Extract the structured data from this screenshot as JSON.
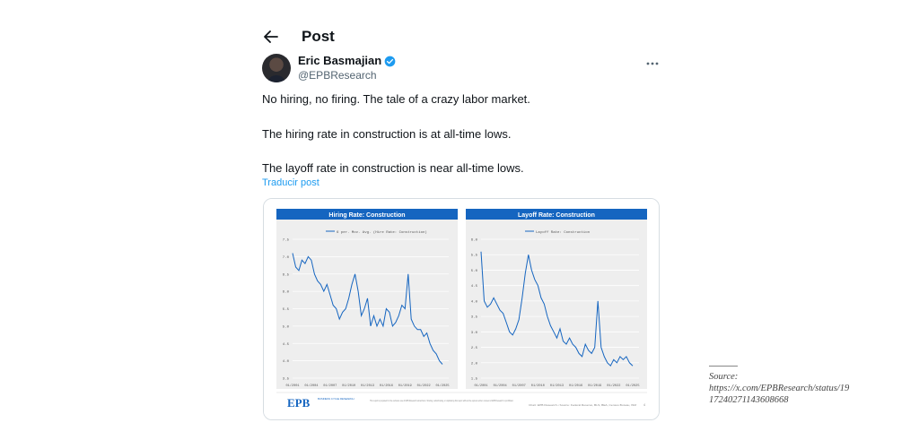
{
  "header": {
    "title": "Post",
    "back_icon": "arrow-left-icon"
  },
  "author": {
    "name": "Eric Basmajian",
    "handle": "@EPBResearch",
    "verified": true,
    "verified_color": "#1d9bf0"
  },
  "tweet": {
    "lines": [
      "No hiring, no firing. The tale of a crazy labor market.",
      "The hiring rate in construction is at all-time lows.",
      "The layoff rate in construction is near all-time lows."
    ],
    "translate_label": "Traducir post"
  },
  "charts_panel": {
    "brand_logo": "EPB",
    "brand_tagline": "BUSINESS CYCLE RESEARCH",
    "disclaimer": "This report is prepared for the exclusive use of EPB Research subscribers. Sharing, redistributing, or duplicating this report without the express written consent of EPB Research is prohibited.",
    "footer_source": "Chart: EPB Research  •  Source: Federal Reserve, BLS, BEA, Census Bureau, ISM",
    "page_number": "4",
    "accent_color": "#1565c0"
  },
  "chart_data": [
    {
      "type": "line",
      "title": "Hiring Rate: Construction",
      "legend": [
        "6 per. Mov. Avg. (Hire Rate: Construction)"
      ],
      "x_tick_labels": [
        "01/2001",
        "01/2004",
        "01/2007",
        "01/2010",
        "01/2013",
        "01/2016",
        "01/2019",
        "01/2022",
        "01/2025"
      ],
      "y_tick_labels": [
        "3.5",
        "4.0",
        "4.5",
        "5.0",
        "5.5",
        "6.0",
        "6.5",
        "7.0",
        "7.5"
      ],
      "ylim": [
        3.5,
        7.5
      ],
      "x": [
        2001,
        2001.5,
        2002,
        2002.5,
        2003,
        2003.5,
        2004,
        2004.5,
        2005,
        2005.5,
        2006,
        2006.5,
        2007,
        2007.5,
        2008,
        2008.5,
        2009,
        2009.5,
        2010,
        2010.5,
        2011,
        2011.5,
        2012,
        2012.5,
        2013,
        2013.5,
        2014,
        2014.5,
        2015,
        2015.5,
        2016,
        2016.5,
        2017,
        2017.5,
        2018,
        2018.5,
        2019,
        2019.5,
        2020,
        2020.5,
        2021,
        2021.5,
        2022,
        2022.5,
        2023,
        2023.5,
        2024,
        2024.5,
        2025
      ],
      "series": [
        {
          "name": "6 per. Mov. Avg. (Hire Rate: Construction)",
          "values": [
            7.1,
            6.7,
            6.6,
            6.9,
            6.8,
            7.0,
            6.9,
            6.5,
            6.3,
            6.2,
            6.0,
            6.2,
            5.9,
            5.6,
            5.5,
            5.2,
            5.4,
            5.5,
            5.8,
            6.2,
            6.5,
            6.0,
            5.3,
            5.5,
            5.8,
            5.0,
            5.3,
            5.0,
            5.2,
            5.0,
            5.5,
            5.4,
            5.0,
            5.1,
            5.3,
            5.6,
            5.5,
            6.5,
            5.2,
            5.0,
            4.9,
            4.9,
            4.7,
            4.8,
            4.5,
            4.3,
            4.2,
            4.0,
            3.9
          ]
        }
      ]
    },
    {
      "type": "line",
      "title": "Layoff Rate: Construction",
      "legend": [
        "Layoff Rate: Construction"
      ],
      "x_tick_labels": [
        "01/2001",
        "01/2004",
        "01/2007",
        "01/2010",
        "01/2013",
        "01/2016",
        "01/2019",
        "01/2022",
        "01/2025"
      ],
      "y_tick_labels": [
        "1.5",
        "2.0",
        "2.5",
        "3.0",
        "3.5",
        "4.0",
        "4.5",
        "5.0",
        "5.5",
        "6.0"
      ],
      "ylim": [
        1.5,
        6.0
      ],
      "x": [
        2001,
        2001.5,
        2002,
        2002.5,
        2003,
        2003.5,
        2004,
        2004.5,
        2005,
        2005.5,
        2006,
        2006.5,
        2007,
        2007.5,
        2008,
        2008.5,
        2009,
        2009.5,
        2010,
        2010.5,
        2011,
        2011.5,
        2012,
        2012.5,
        2013,
        2013.5,
        2014,
        2014.5,
        2015,
        2015.5,
        2016,
        2016.5,
        2017,
        2017.5,
        2018,
        2018.5,
        2019,
        2019.5,
        2020,
        2020.5,
        2021,
        2021.5,
        2022,
        2022.5,
        2023,
        2023.5,
        2024,
        2024.5,
        2025
      ],
      "series": [
        {
          "name": "Layoff Rate: Construction",
          "values": [
            5.6,
            4.0,
            3.8,
            3.9,
            4.1,
            3.9,
            3.7,
            3.6,
            3.3,
            3.0,
            2.9,
            3.1,
            3.4,
            4.1,
            4.9,
            5.5,
            5.0,
            4.7,
            4.5,
            4.1,
            3.9,
            3.5,
            3.2,
            3.0,
            2.8,
            3.1,
            2.7,
            2.6,
            2.8,
            2.6,
            2.5,
            2.3,
            2.2,
            2.6,
            2.4,
            2.3,
            2.5,
            4.0,
            2.5,
            2.2,
            2.0,
            1.9,
            2.1,
            2.0,
            2.2,
            2.1,
            2.2,
            2.0,
            1.9
          ]
        }
      ]
    }
  ],
  "source_note": {
    "label": "Source:",
    "url": "https://x.com/EPBResearch/status/1917240271143608668"
  }
}
